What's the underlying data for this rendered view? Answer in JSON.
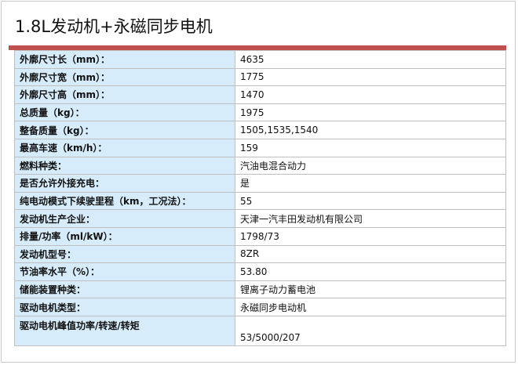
{
  "title": "1.8L发动机+永磁同步电机",
  "rows": [
    {
      "label": "外廓尺寸长（mm）：",
      "value": "4635"
    },
    {
      "label": "外廓尺寸宽（mm）：",
      "value": "1775"
    },
    {
      "label": "外廓尺寸高（mm）：",
      "value": "1470"
    },
    {
      "label": "总质量（kg）：",
      "value": "1975"
    },
    {
      "label": "整备质量（kg）：",
      "value": "1505,1535,1540"
    },
    {
      "label": "最高车速（km/h）：",
      "value": "159"
    },
    {
      "label": "燃料种类：",
      "value": "汽油电混合动力"
    },
    {
      "label": "是否允许外接充电：",
      "value": "是"
    },
    {
      "label": "纯电动模式下续驶里程（km，工况法）：",
      "value": "55"
    },
    {
      "label": "发动机生产企业：",
      "value": "天津一汽丰田发动机有限公司"
    },
    {
      "label": "排量/功率（ml/kW）：",
      "value": "1798/73"
    },
    {
      "label": "发动机型号：",
      "value": "8ZR"
    },
    {
      "label": "节油率水平（%）：",
      "value": "53.80"
    },
    {
      "label": "储能装置种类：",
      "value": "锂离子动力蓄电池"
    },
    {
      "label": "驱动电机类型：",
      "value": "永磁同步电动机"
    },
    {
      "label": "驱动电机峰值功率/转速/转矩",
      "value": "53/5000/207"
    }
  ],
  "colors": {
    "accent_bar": "#c0504d",
    "label_bg": "#d6ecfa",
    "border": "#bfbfbf"
  }
}
